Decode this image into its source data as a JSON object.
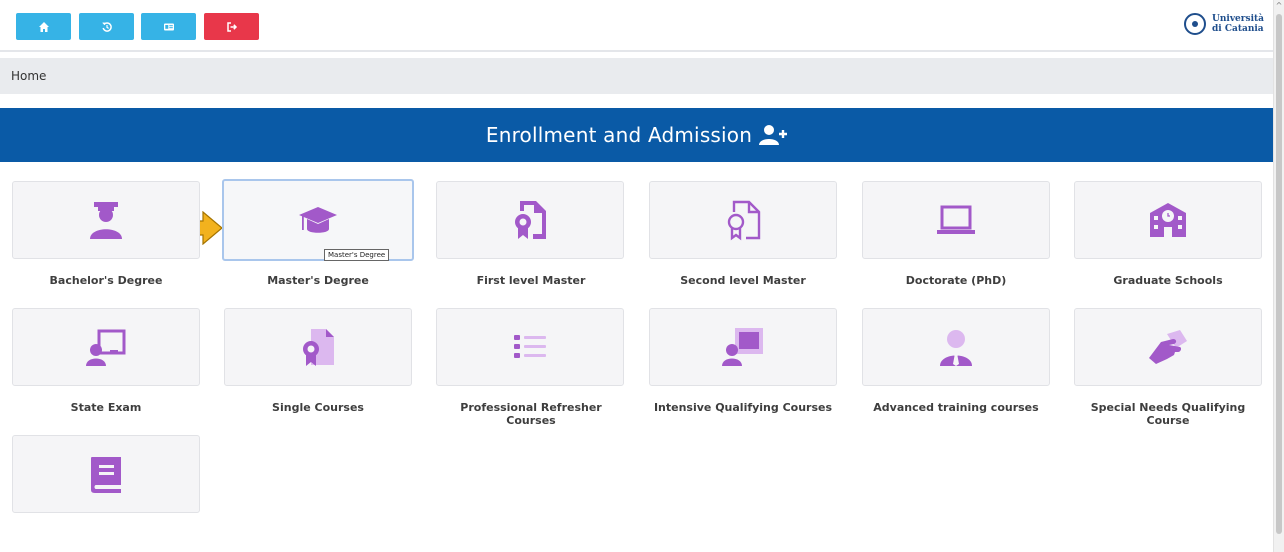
{
  "toolbar": {
    "home": {
      "icon": "home-icon",
      "color": "#36b3e6"
    },
    "back": {
      "icon": "history-icon",
      "color": "#36b3e6"
    },
    "id": {
      "icon": "id-card-icon",
      "color": "#36b3e6"
    },
    "logout": {
      "icon": "logout-icon",
      "color": "#e8374a"
    }
  },
  "logo": {
    "line1": "Università",
    "line2": "di Catania"
  },
  "breadcrumb": {
    "text": "Home"
  },
  "banner": {
    "title": "Enrollment and Admission",
    "icon": "user-plus-icon",
    "color": "#0a5aa6"
  },
  "accent_color": "#a259c9",
  "cards": [
    {
      "label": "Bachelor's Degree",
      "icon": "graduate-icon"
    },
    {
      "label": "Master's Degree",
      "icon": "graduation-cap-icon",
      "selected": true,
      "tooltip": "Master's Degree"
    },
    {
      "label": "First level Master",
      "icon": "certificate-doc-icon"
    },
    {
      "label": "Second level Master",
      "icon": "certificate-doc-outline-icon"
    },
    {
      "label": "Doctorate (PhD)",
      "icon": "laptop-icon"
    },
    {
      "label": "Graduate Schools",
      "icon": "school-icon"
    },
    {
      "label": "State Exam",
      "icon": "chalkboard-teacher-icon"
    },
    {
      "label": "Single Courses",
      "icon": "certificate-file-icon"
    },
    {
      "label": "Professional Refresher Courses",
      "icon": "list-icon"
    },
    {
      "label": "Intensive Qualifying Courses",
      "icon": "presentation-icon"
    },
    {
      "label": "Advanced training courses",
      "icon": "user-tie-icon"
    },
    {
      "label": "Special Needs Qualifying Course",
      "icon": "handshake-icon"
    },
    {
      "label": "",
      "icon": "book-icon"
    }
  ],
  "pointer": {
    "icon": "arrow-right-icon",
    "color": "#f2b21e"
  }
}
